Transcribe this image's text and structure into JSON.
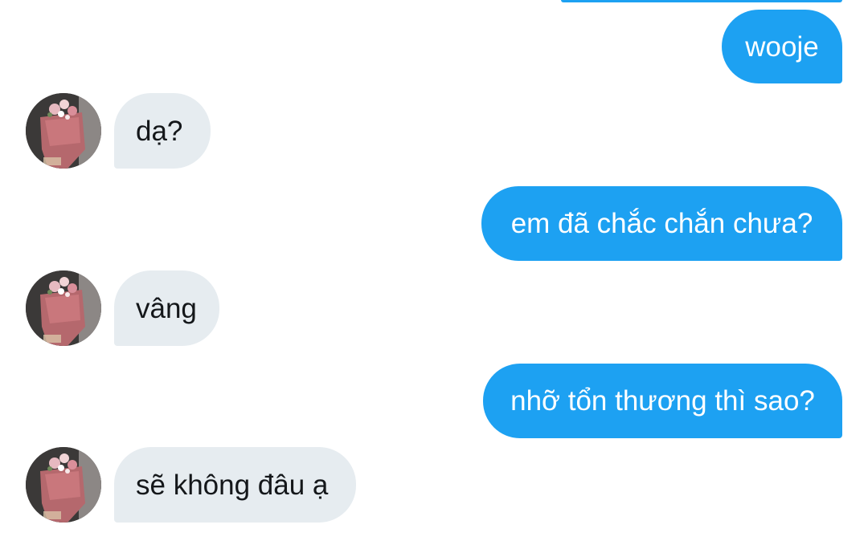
{
  "colors": {
    "sent_bubble": "#1da1f2",
    "received_bubble": "#e6ecf0",
    "sent_text": "#ffffff",
    "received_text": "#14171a"
  },
  "messages": [
    {
      "direction": "sent",
      "text": "wooje"
    },
    {
      "direction": "received",
      "text": "dạ?",
      "avatar": "contact-avatar-bouquet-photo"
    },
    {
      "direction": "sent",
      "text": "em đã chắc chắn chưa?"
    },
    {
      "direction": "received",
      "text": "vâng",
      "avatar": "contact-avatar-bouquet-photo"
    },
    {
      "direction": "sent",
      "text": "nhỡ tổn thương thì sao?"
    },
    {
      "direction": "received",
      "text": "sẽ không đâu ạ",
      "avatar": "contact-avatar-bouquet-photo"
    }
  ]
}
